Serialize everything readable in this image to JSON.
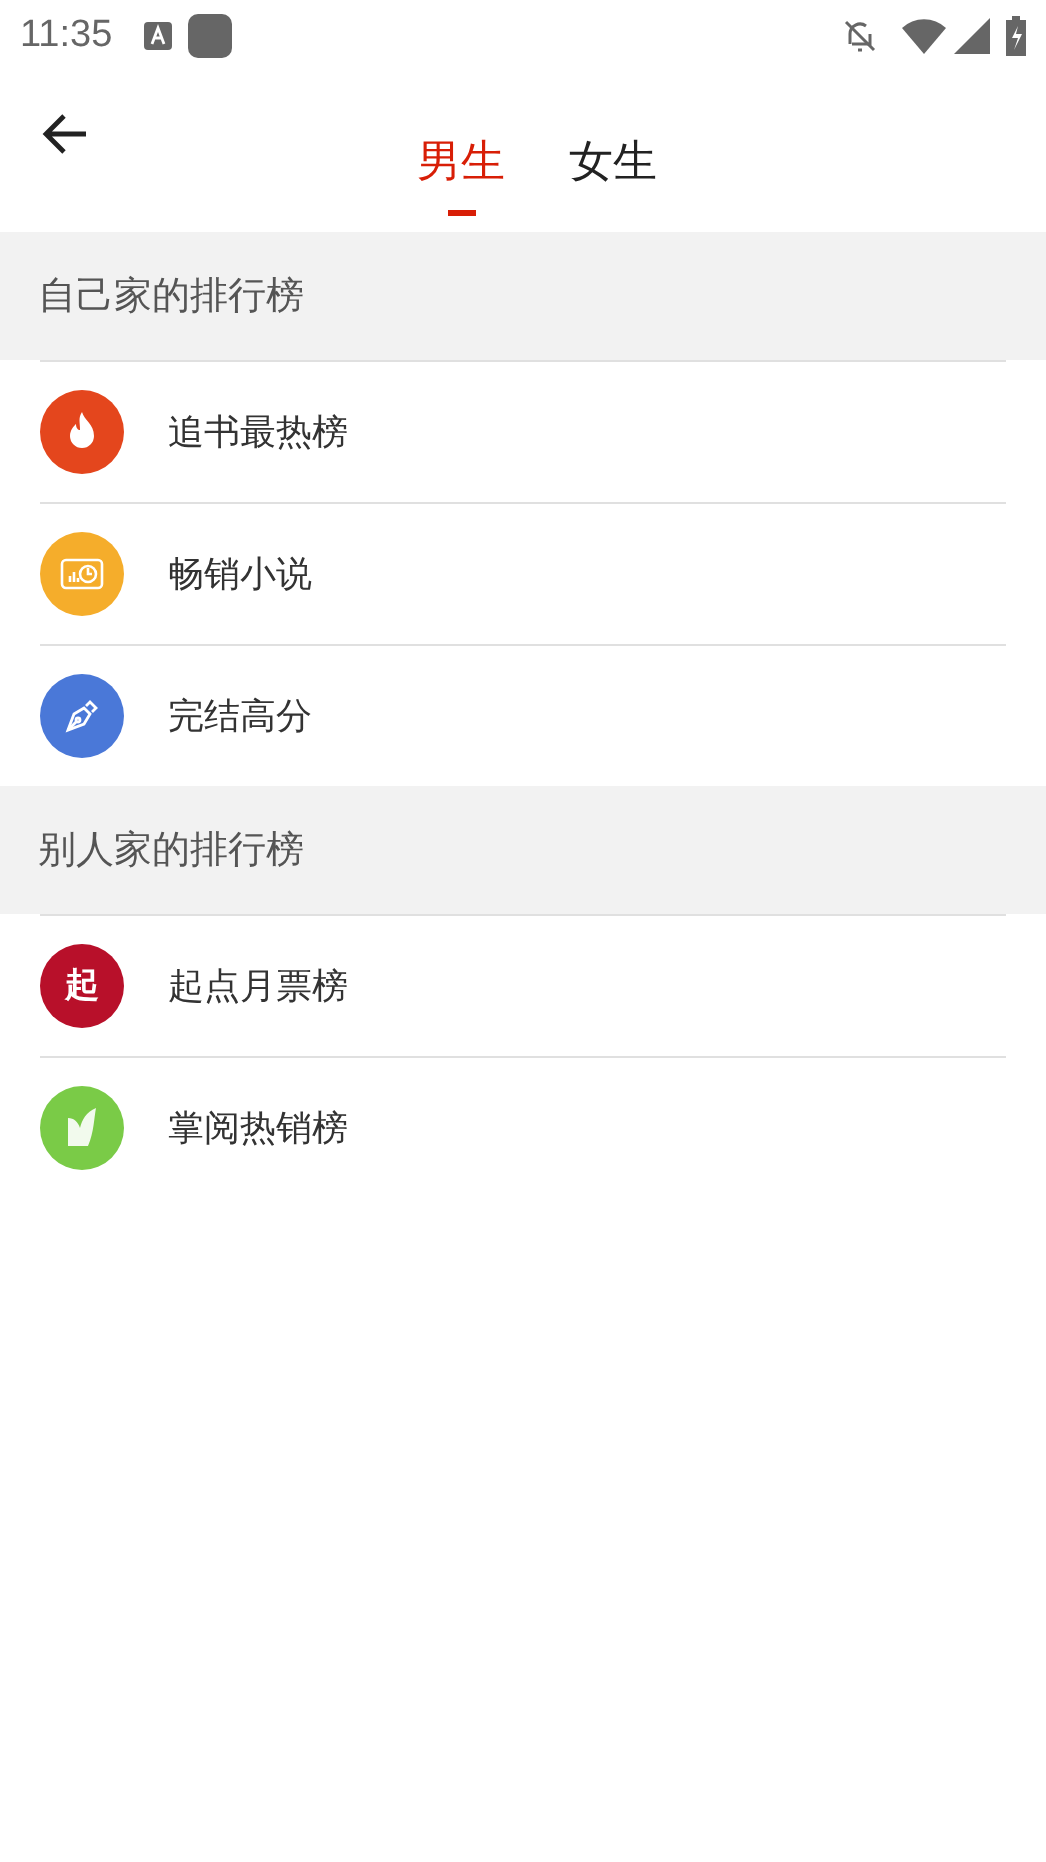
{
  "status_bar": {
    "time": "11:35"
  },
  "tabs": [
    {
      "label": "男生",
      "selected": true
    },
    {
      "label": "女生",
      "selected": false
    }
  ],
  "sections": [
    {
      "title": "自己家的排行榜",
      "items": [
        {
          "label": "追书最热榜",
          "kind": "fire",
          "color": "#e4461d"
        },
        {
          "label": "畅销小说",
          "kind": "chart",
          "color": "#f5ad2b"
        },
        {
          "label": "完结高分",
          "kind": "pen",
          "color": "#4a78d8"
        }
      ]
    },
    {
      "title": "别人家的排行榜",
      "items": [
        {
          "label": "起点月票榜",
          "kind": "logo",
          "color": "#b8102a",
          "logo_text": "起"
        },
        {
          "label": "掌阅热销榜",
          "kind": "book",
          "color": "#7acb47"
        }
      ]
    }
  ]
}
